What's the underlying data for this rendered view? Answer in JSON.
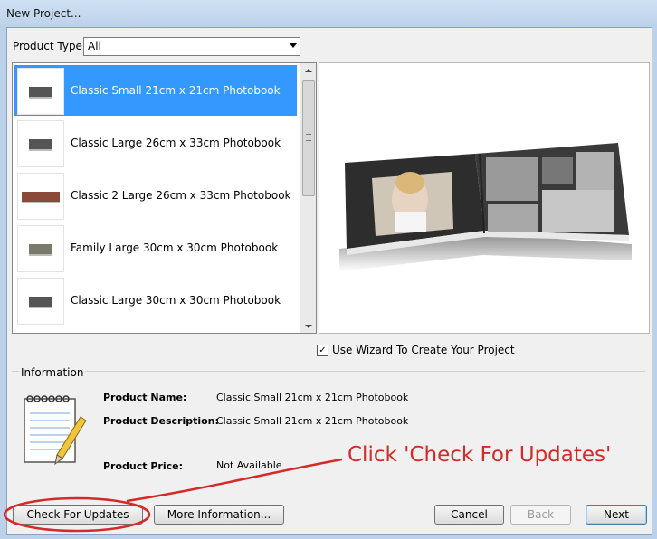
{
  "window": {
    "title": "New Project..."
  },
  "product_type": {
    "label": "Product Type:",
    "value": "All"
  },
  "products": [
    {
      "label": "Classic Small 21cm x 21cm Photobook",
      "selected": true,
      "thumb_icon": "photobook-thumbnail-icon"
    },
    {
      "label": "Classic Large 26cm x 33cm Photobook",
      "selected": false,
      "thumb_icon": "photobook-thumbnail-icon"
    },
    {
      "label": "Classic 2 Large 26cm x 33cm Photobook",
      "selected": false,
      "thumb_icon": "photobook-thumbnail-icon"
    },
    {
      "label": "Family Large 30cm x 30cm Photobook",
      "selected": false,
      "thumb_icon": "photobook-thumbnail-icon"
    },
    {
      "label": "Classic Large 30cm x 30cm Photobook",
      "selected": false,
      "thumb_icon": "photobook-thumbnail-icon"
    }
  ],
  "wizard": {
    "label": "Use Wizard To Create Your Project",
    "checked": true
  },
  "info": {
    "heading": "Information",
    "name_label": "Product Name:",
    "name_value": "Classic Small 21cm x 21cm Photobook",
    "desc_label": "Product Description:",
    "desc_value": "Classic Small 21cm x 21cm Photobook",
    "price_label": "Product Price:",
    "price_value": "Not Available"
  },
  "buttons": {
    "check_updates": "Check For Updates",
    "more_info": "More Information...",
    "cancel": "Cancel",
    "back": "Back",
    "next": "Next"
  },
  "annotation": {
    "text": "Click 'Check For Updates'",
    "color": "#d42a2a"
  },
  "colors": {
    "selection": "#3399ff",
    "titlebar": "#bcd2ea"
  }
}
